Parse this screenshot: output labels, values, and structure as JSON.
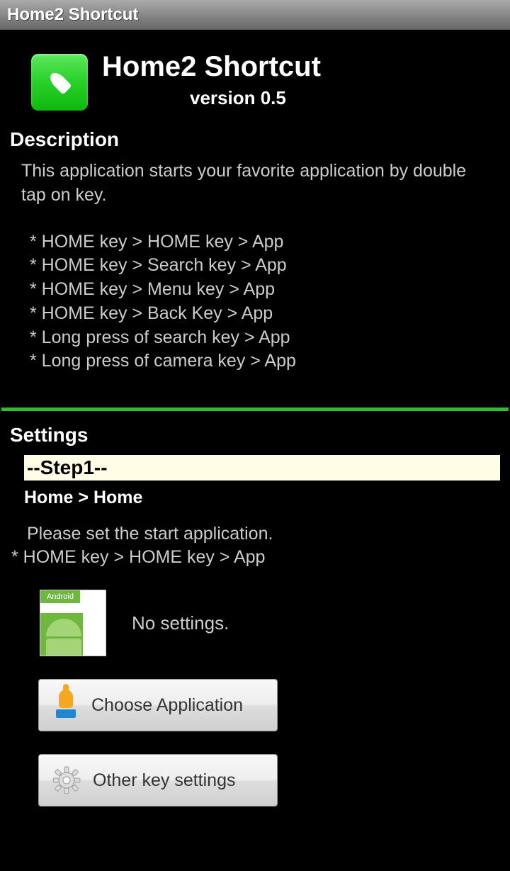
{
  "titlebar": {
    "text": "Home2 Shortcut"
  },
  "header": {
    "app_title": "Home2 Shortcut",
    "version": "version 0.5"
  },
  "description": {
    "heading": "Description",
    "intro": "This application starts your favorite application by double tap on key.",
    "bullets": [
      "* HOME key > HOME key > App",
      "* HOME key > Search key > App",
      "* HOME key > Menu key > App",
      "* HOME key > Back Key > App",
      "* Long press of search key > App",
      "* Long press of camera key > App"
    ]
  },
  "settings": {
    "heading": "Settings",
    "step_label": "--Step1--",
    "step_path": "Home > Home",
    "instr_line1": "Please set the start application.",
    "instr_bullet": " * HOME key > HOME key > App",
    "android_tab": "Android",
    "status": "No settings.",
    "choose_button": "Choose Application",
    "other_button": "Other key settings"
  }
}
